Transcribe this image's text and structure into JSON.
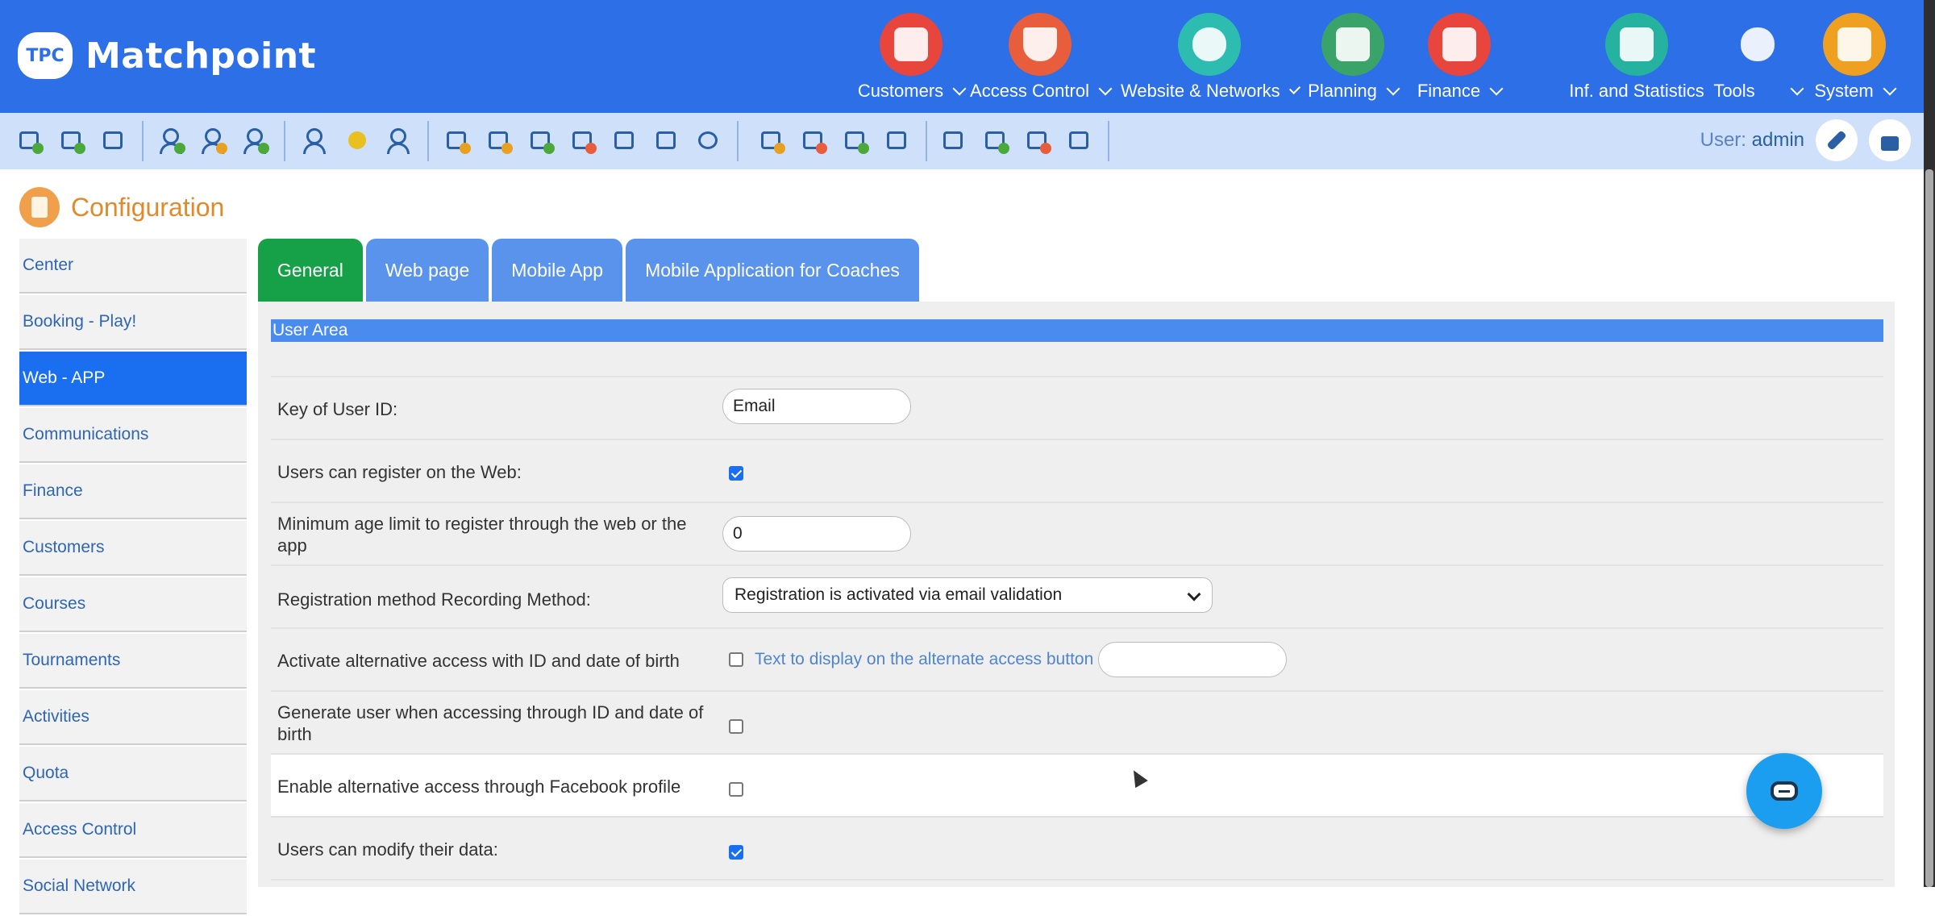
{
  "app": {
    "logo_badge": "TPC",
    "name": "Matchpoint"
  },
  "modules": [
    {
      "label": "Customers",
      "icon": "customers-icon",
      "color": "#e8453c"
    },
    {
      "label": "Access Control",
      "icon": "access-shield-icon",
      "color": "#e85d3c"
    },
    {
      "label": "Website & Networks",
      "icon": "cloud-network-icon",
      "color": "#2cbdb0"
    },
    {
      "label": "Planning",
      "icon": "calendar-icon",
      "color": "#3aa36a"
    },
    {
      "label": "Finance",
      "icon": "calculator-icon",
      "color": "#e8453c"
    },
    {
      "label": "Inf. and Statistics",
      "icon": "statistics-icon",
      "color": "#25b3a0"
    },
    {
      "label": "Tools",
      "icon": "gears-icon",
      "color": "#2d6fe6"
    },
    {
      "label": "System",
      "icon": "folder-gear-icon",
      "color": "#f0a020"
    }
  ],
  "user": {
    "prefix": "User:",
    "name": "admin"
  },
  "page": {
    "title": "Configuration"
  },
  "sidebar": {
    "items": [
      {
        "label": "Center"
      },
      {
        "label": "Booking - Play!"
      },
      {
        "label": "Web - APP"
      },
      {
        "label": "Communications"
      },
      {
        "label": "Finance"
      },
      {
        "label": "Customers"
      },
      {
        "label": "Courses"
      },
      {
        "label": "Tournaments"
      },
      {
        "label": "Activities"
      },
      {
        "label": "Quota"
      },
      {
        "label": "Access Control"
      },
      {
        "label": "Social Network"
      }
    ],
    "active": "Web - APP"
  },
  "tabs": [
    {
      "label": "General"
    },
    {
      "label": "Web page"
    },
    {
      "label": "Mobile App"
    },
    {
      "label": "Mobile Application for Coaches"
    }
  ],
  "section": {
    "title": "User Area"
  },
  "form": {
    "key_user_id": {
      "label": "Key of User ID:",
      "value": "Email"
    },
    "register_web": {
      "label": "Users can register on the Web:",
      "checked": true
    },
    "min_age": {
      "label": "Minimum age limit to register through the web or the app",
      "value": "0"
    },
    "reg_method": {
      "label": "Registration method Recording Method:",
      "value": "Registration is activated via email validation"
    },
    "alt_access": {
      "label": "Activate alternative access with ID and date of birth",
      "checked": false,
      "button_text_label": "Text to display on the alternate access button",
      "button_text_value": ""
    },
    "generate_user": {
      "label": "Generate user when accessing through ID and date of birth",
      "checked": false
    },
    "facebook": {
      "label": "Enable alternative access through Facebook profile",
      "checked": false
    },
    "modify_data": {
      "label": "Users can modify their data:",
      "checked": true
    }
  }
}
